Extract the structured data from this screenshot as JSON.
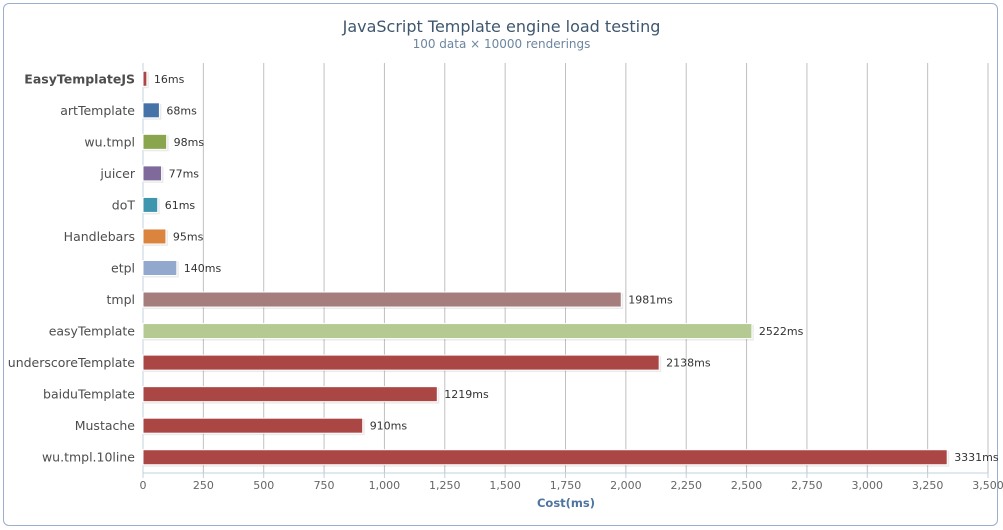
{
  "chart_data": {
    "type": "bar",
    "orientation": "horizontal",
    "title": "JavaScript Template engine load testing",
    "subtitle": "100 data × 10000 renderings",
    "xlabel": "Cost(ms)",
    "xlim": [
      0,
      3500
    ],
    "xticks": [
      "0",
      "250",
      "500",
      "750",
      "1,000",
      "1,250",
      "1,500",
      "1,750",
      "2,000",
      "2,250",
      "2,500",
      "2,750",
      "3,000",
      "3,250",
      "3,500"
    ],
    "grid": true,
    "legend": "none",
    "bold_category": "EasyTemplateJS",
    "categories": [
      "EasyTemplateJS",
      "artTemplate",
      "wu.tmpl",
      "juicer",
      "doT",
      "Handlebars",
      "etpl",
      "tmpl",
      "easyTemplate",
      "underscoreTemplate",
      "baiduTemplate",
      "Mustache",
      "wu.tmpl.10line"
    ],
    "values": [
      16,
      68,
      98,
      77,
      61,
      95,
      140,
      1981,
      2522,
      2138,
      1219,
      910,
      3331
    ],
    "data_labels": [
      "16ms",
      "68ms",
      "98ms",
      "77ms",
      "61ms",
      "95ms",
      "140ms",
      "1981ms",
      "2522ms",
      "2138ms",
      "1219ms",
      "910ms",
      "3331ms"
    ],
    "colors": [
      "#aa4643",
      "#4572a7",
      "#89a54e",
      "#80699b",
      "#3d96ae",
      "#db843d",
      "#92a8cd",
      "#a47d7c",
      "#b5ca92",
      "#aa4643",
      "#aa4643",
      "#aa4643",
      "#aa4643"
    ]
  }
}
